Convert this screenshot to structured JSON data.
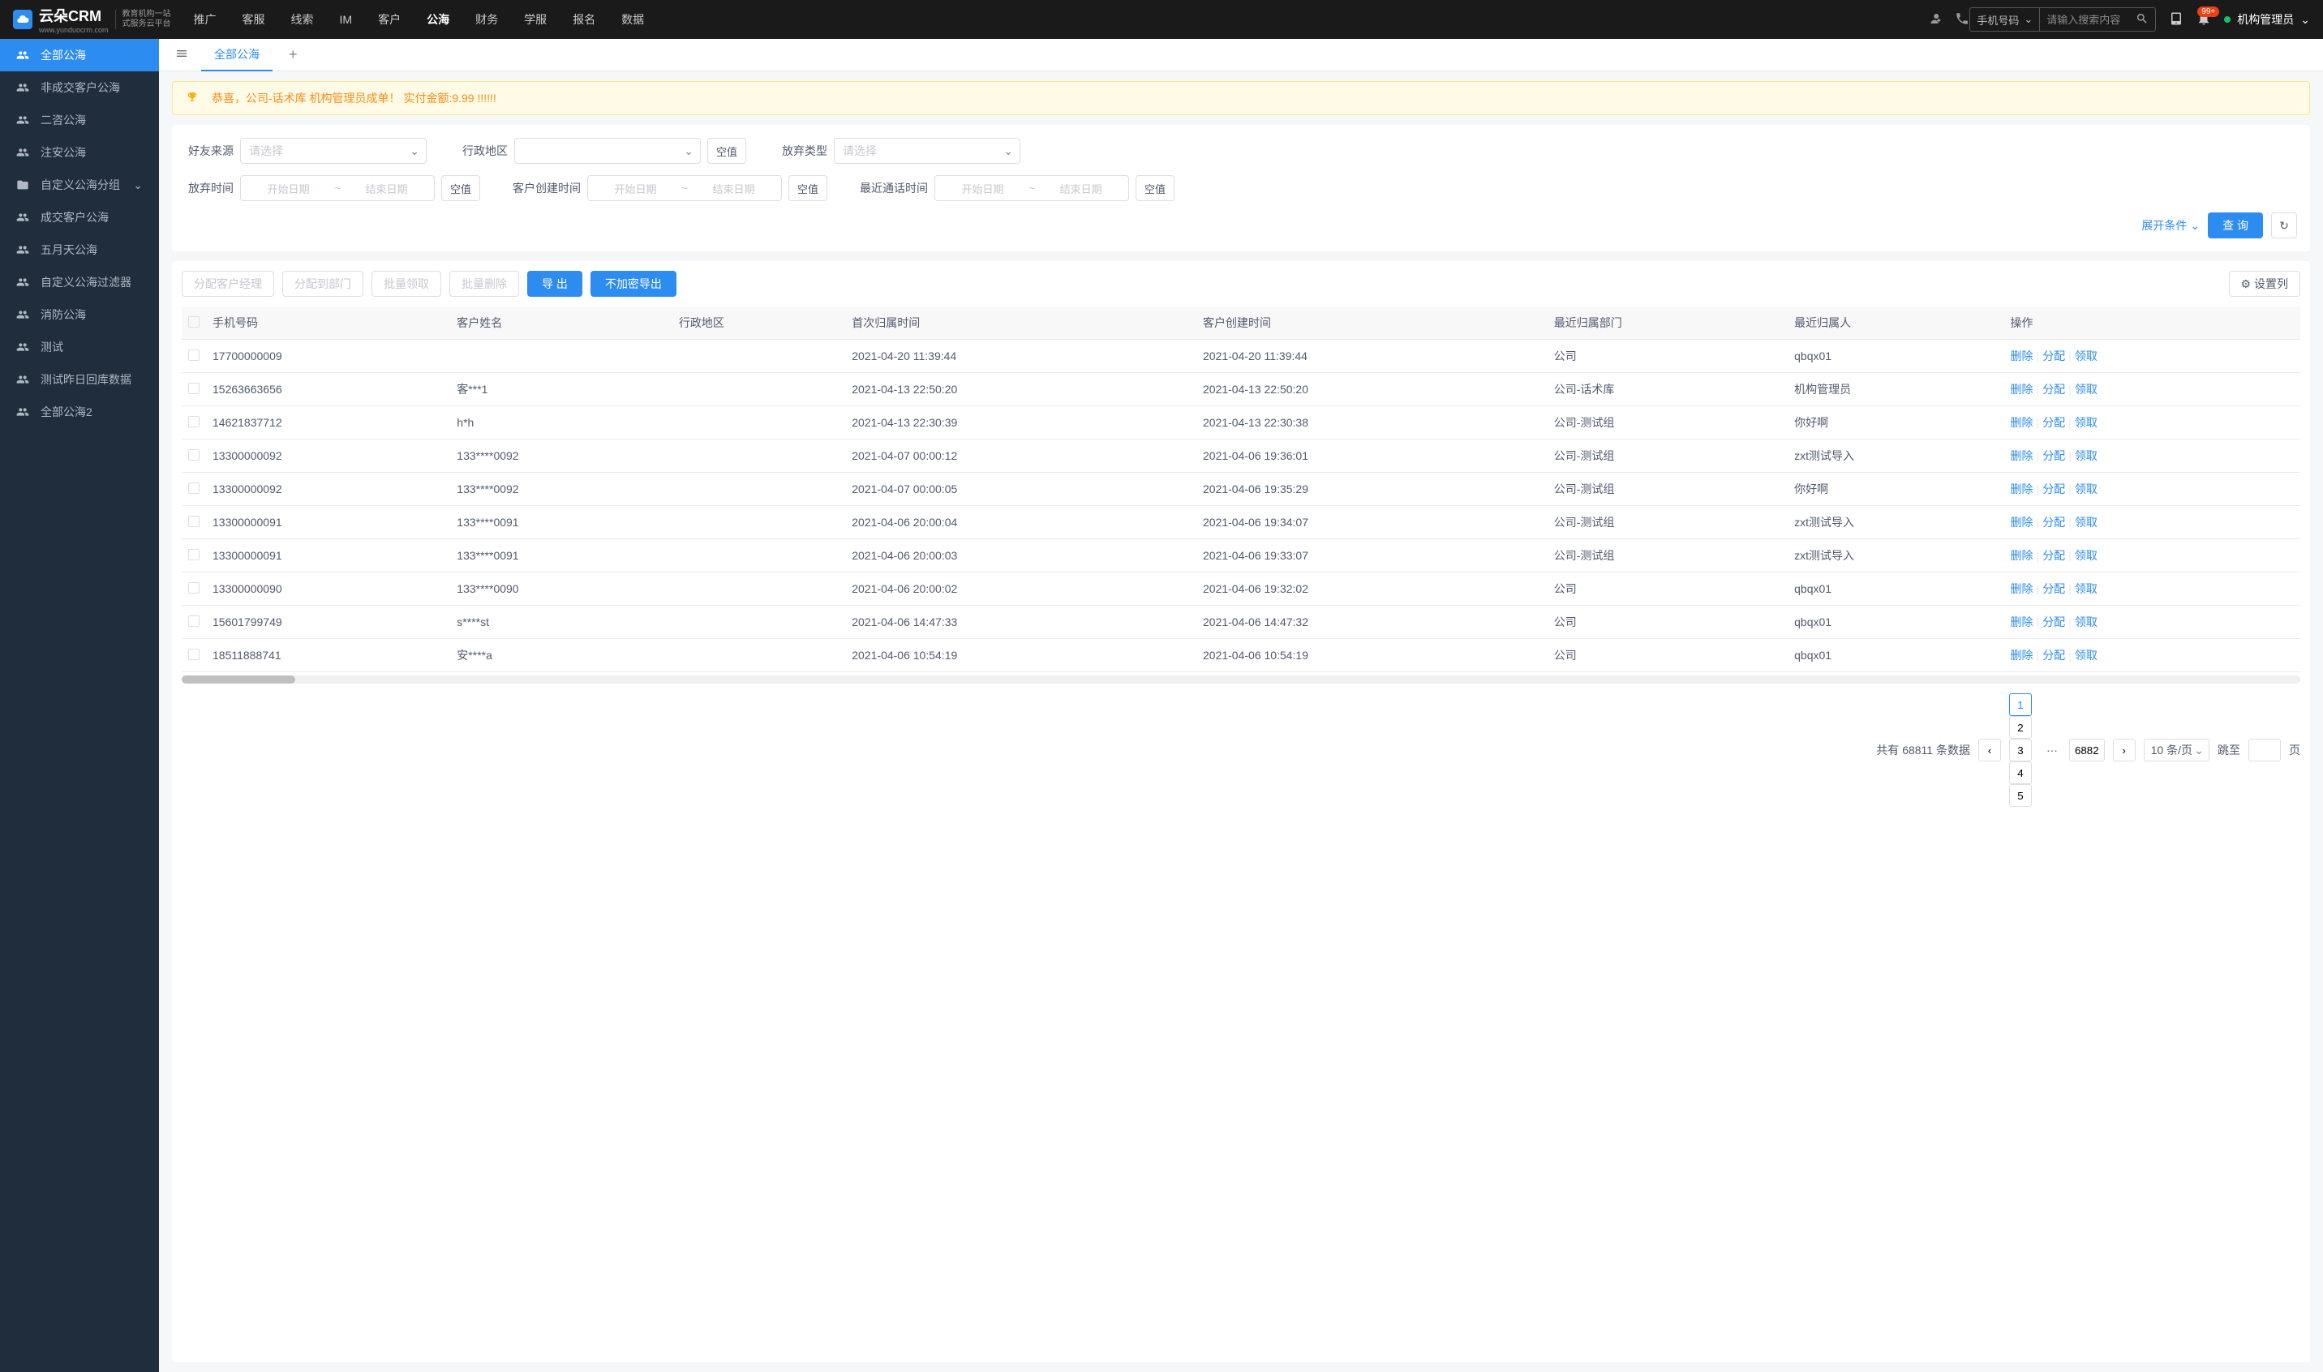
{
  "header": {
    "logo_main": "云朵CRM",
    "logo_sub1": "教育机构一站",
    "logo_sub2": "式服务云平台",
    "logo_url": "www.yunduocrm.com",
    "nav": [
      "推广",
      "客服",
      "线索",
      "IM",
      "客户",
      "公海",
      "财务",
      "学服",
      "报名",
      "数据"
    ],
    "nav_active": "公海",
    "search_type": "手机号码",
    "search_placeholder": "请输入搜索内容",
    "badge": "99+",
    "user": "机构管理员"
  },
  "sidebar": {
    "items": [
      {
        "label": "全部公海",
        "icon": "users",
        "active": true
      },
      {
        "label": "非成交客户公海",
        "icon": "users"
      },
      {
        "label": "二咨公海",
        "icon": "users"
      },
      {
        "label": "注安公海",
        "icon": "users"
      },
      {
        "label": "自定义公海分组",
        "icon": "folder",
        "arrow": true
      },
      {
        "label": "成交客户公海",
        "icon": "users"
      },
      {
        "label": "五月天公海",
        "icon": "users"
      },
      {
        "label": "自定义公海过滤器",
        "icon": "users"
      },
      {
        "label": "消防公海",
        "icon": "users"
      },
      {
        "label": "测试",
        "icon": "users"
      },
      {
        "label": "测试昨日回库数据",
        "icon": "users"
      },
      {
        "label": "全部公海2",
        "icon": "users"
      }
    ]
  },
  "tabs": {
    "active": "全部公海"
  },
  "notice": "恭喜，公司-话术库  机构管理员成单！ 实付金额:9.99 !!!!!!",
  "filters": {
    "friend_source": {
      "label": "好友来源",
      "placeholder": "请选择"
    },
    "region": {
      "label": "行政地区",
      "empty_btn": "空值"
    },
    "abandon_type": {
      "label": "放弃类型",
      "placeholder": "请选择"
    },
    "abandon_time": {
      "label": "放弃时间",
      "start": "开始日期",
      "end": "结束日期",
      "empty_btn": "空值"
    },
    "create_time": {
      "label": "客户创建时间",
      "start": "开始日期",
      "end": "结束日期",
      "empty_btn": "空值"
    },
    "call_time": {
      "label": "最近通话时间",
      "start": "开始日期",
      "end": "结束日期",
      "empty_btn": "空值"
    },
    "expand": "展开条件",
    "query": "查 询"
  },
  "toolbar": {
    "assign_manager": "分配客户经理",
    "assign_dept": "分配到部门",
    "batch_claim": "批量领取",
    "batch_delete": "批量删除",
    "export": "导 出",
    "export_plain": "不加密导出",
    "set_columns": "设置列"
  },
  "table": {
    "headers": [
      "手机号码",
      "客户姓名",
      "行政地区",
      "首次归属时间",
      "客户创建时间",
      "最近归属部门",
      "最近归属人",
      "操作"
    ],
    "actions": {
      "delete": "删除",
      "assign": "分配",
      "claim": "领取"
    },
    "rows": [
      {
        "phone": "17700000009",
        "name": "",
        "region": "",
        "first_time": "2021-04-20 11:39:44",
        "create_time": "2021-04-20 11:39:44",
        "dept": "公司",
        "owner": "qbqx01"
      },
      {
        "phone": "15263663656",
        "name": "客***1",
        "region": "",
        "first_time": "2021-04-13 22:50:20",
        "create_time": "2021-04-13 22:50:20",
        "dept": "公司-话术库",
        "owner": "机构管理员"
      },
      {
        "phone": "14621837712",
        "name": "h*h",
        "region": "",
        "first_time": "2021-04-13 22:30:39",
        "create_time": "2021-04-13 22:30:38",
        "dept": "公司-测试组",
        "owner": "你好啊"
      },
      {
        "phone": "13300000092",
        "name": "133****0092",
        "region": "",
        "first_time": "2021-04-07 00:00:12",
        "create_time": "2021-04-06 19:36:01",
        "dept": "公司-测试组",
        "owner": "zxt测试导入"
      },
      {
        "phone": "13300000092",
        "name": "133****0092",
        "region": "",
        "first_time": "2021-04-07 00:00:05",
        "create_time": "2021-04-06 19:35:29",
        "dept": "公司-测试组",
        "owner": "你好啊"
      },
      {
        "phone": "13300000091",
        "name": "133****0091",
        "region": "",
        "first_time": "2021-04-06 20:00:04",
        "create_time": "2021-04-06 19:34:07",
        "dept": "公司-测试组",
        "owner": "zxt测试导入"
      },
      {
        "phone": "13300000091",
        "name": "133****0091",
        "region": "",
        "first_time": "2021-04-06 20:00:03",
        "create_time": "2021-04-06 19:33:07",
        "dept": "公司-测试组",
        "owner": "zxt测试导入"
      },
      {
        "phone": "13300000090",
        "name": "133****0090",
        "region": "",
        "first_time": "2021-04-06 20:00:02",
        "create_time": "2021-04-06 19:32:02",
        "dept": "公司",
        "owner": "qbqx01"
      },
      {
        "phone": "15601799749",
        "name": "s****st",
        "region": "",
        "first_time": "2021-04-06 14:47:33",
        "create_time": "2021-04-06 14:47:32",
        "dept": "公司",
        "owner": "qbqx01"
      },
      {
        "phone": "18511888741",
        "name": "安****a",
        "region": "",
        "first_time": "2021-04-06 10:54:19",
        "create_time": "2021-04-06 10:54:19",
        "dept": "公司",
        "owner": "qbqx01"
      }
    ]
  },
  "pagination": {
    "total_prefix": "共有",
    "total": "68811",
    "total_suffix": "条数据",
    "pages": [
      "1",
      "2",
      "3",
      "4",
      "5"
    ],
    "last": "6882",
    "size": "10 条/页",
    "jump_label": "跳至",
    "jump_suffix": "页"
  }
}
